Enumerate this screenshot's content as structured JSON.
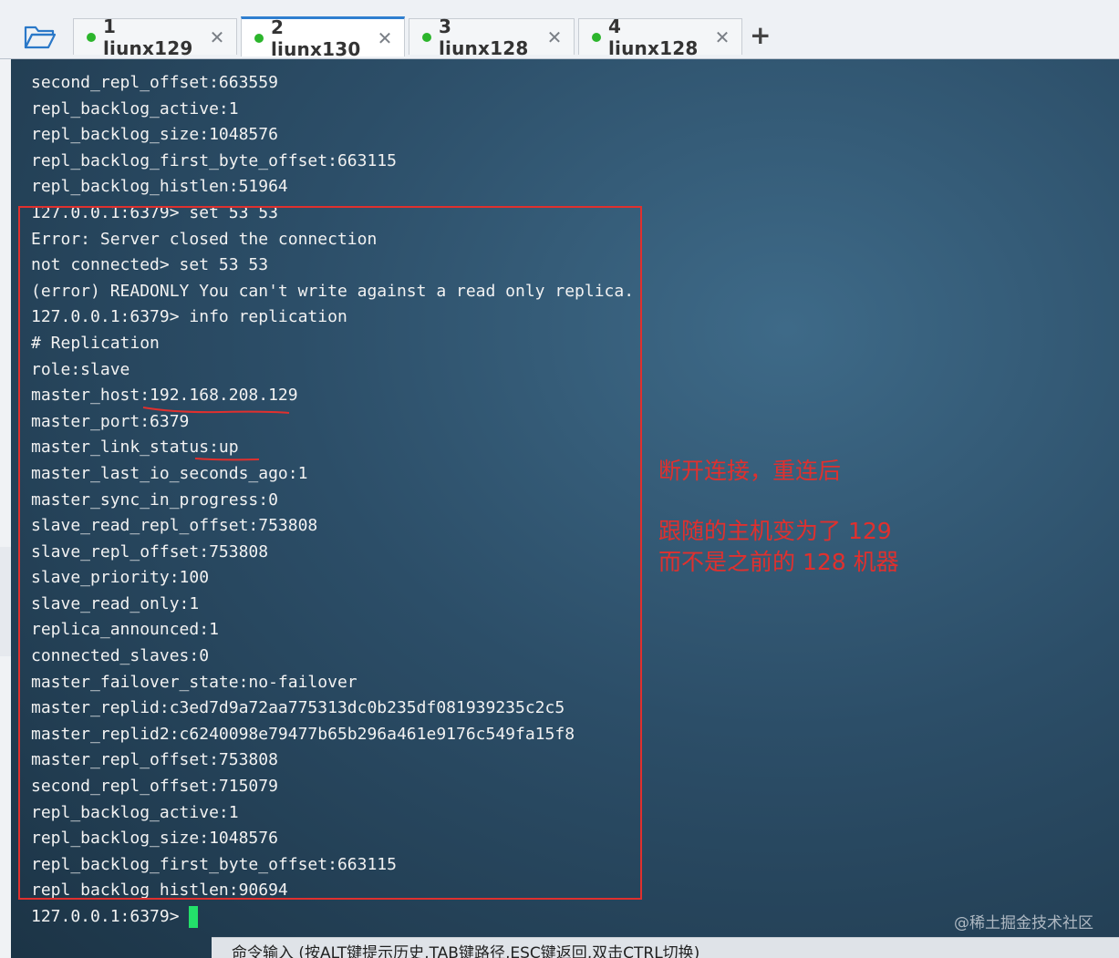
{
  "tabs": [
    {
      "label": "1 liunx129",
      "active": false
    },
    {
      "label": "2 liunx130",
      "active": true
    },
    {
      "label": "3 liunx128",
      "active": false
    },
    {
      "label": "4 liunx128",
      "active": false
    }
  ],
  "tab_close": "✕",
  "new_tab": "+",
  "terminal_lines": [
    "second_repl_offset:663559",
    "repl_backlog_active:1",
    "repl_backlog_size:1048576",
    "repl_backlog_first_byte_offset:663115",
    "repl_backlog_histlen:51964",
    "127.0.0.1:6379> set 53 53",
    "Error: Server closed the connection",
    "not connected> set 53 53",
    "(error) READONLY You can't write against a read only replica.",
    "127.0.0.1:6379> info replication",
    "# Replication",
    "role:slave",
    "master_host:192.168.208.129",
    "master_port:6379",
    "master_link_status:up",
    "master_last_io_seconds_ago:1",
    "master_sync_in_progress:0",
    "slave_read_repl_offset:753808",
    "slave_repl_offset:753808",
    "slave_priority:100",
    "slave_read_only:1",
    "replica_announced:1",
    "connected_slaves:0",
    "master_failover_state:no-failover",
    "master_replid:c3ed7d9a72aa775313dc0b235df081939235c2c5",
    "master_replid2:c6240098e79477b65b296a461e9176c549fa15f8",
    "master_repl_offset:753808",
    "second_repl_offset:715079",
    "repl_backlog_active:1",
    "repl_backlog_size:1048576",
    "repl_backlog_first_byte_offset:663115",
    "repl_backlog_histlen:90694"
  ],
  "prompt": "127.0.0.1:6379>",
  "annotation": {
    "line1": "断开连接，重连后",
    "line2": "跟随的主机变为了 129",
    "line3": "而不是之前的 128 机器"
  },
  "watermark": "@稀土掘金技术社区",
  "bottom_bar": "命令输入 (按ALT键提示历史,TAB键路径,ESC键返回,双击CTRL切换)",
  "colors": {
    "accent": "#e0302e",
    "cursor": "#23e06a",
    "tab_active_border": "#2f7fd0",
    "status_dot": "#2cb52c"
  }
}
